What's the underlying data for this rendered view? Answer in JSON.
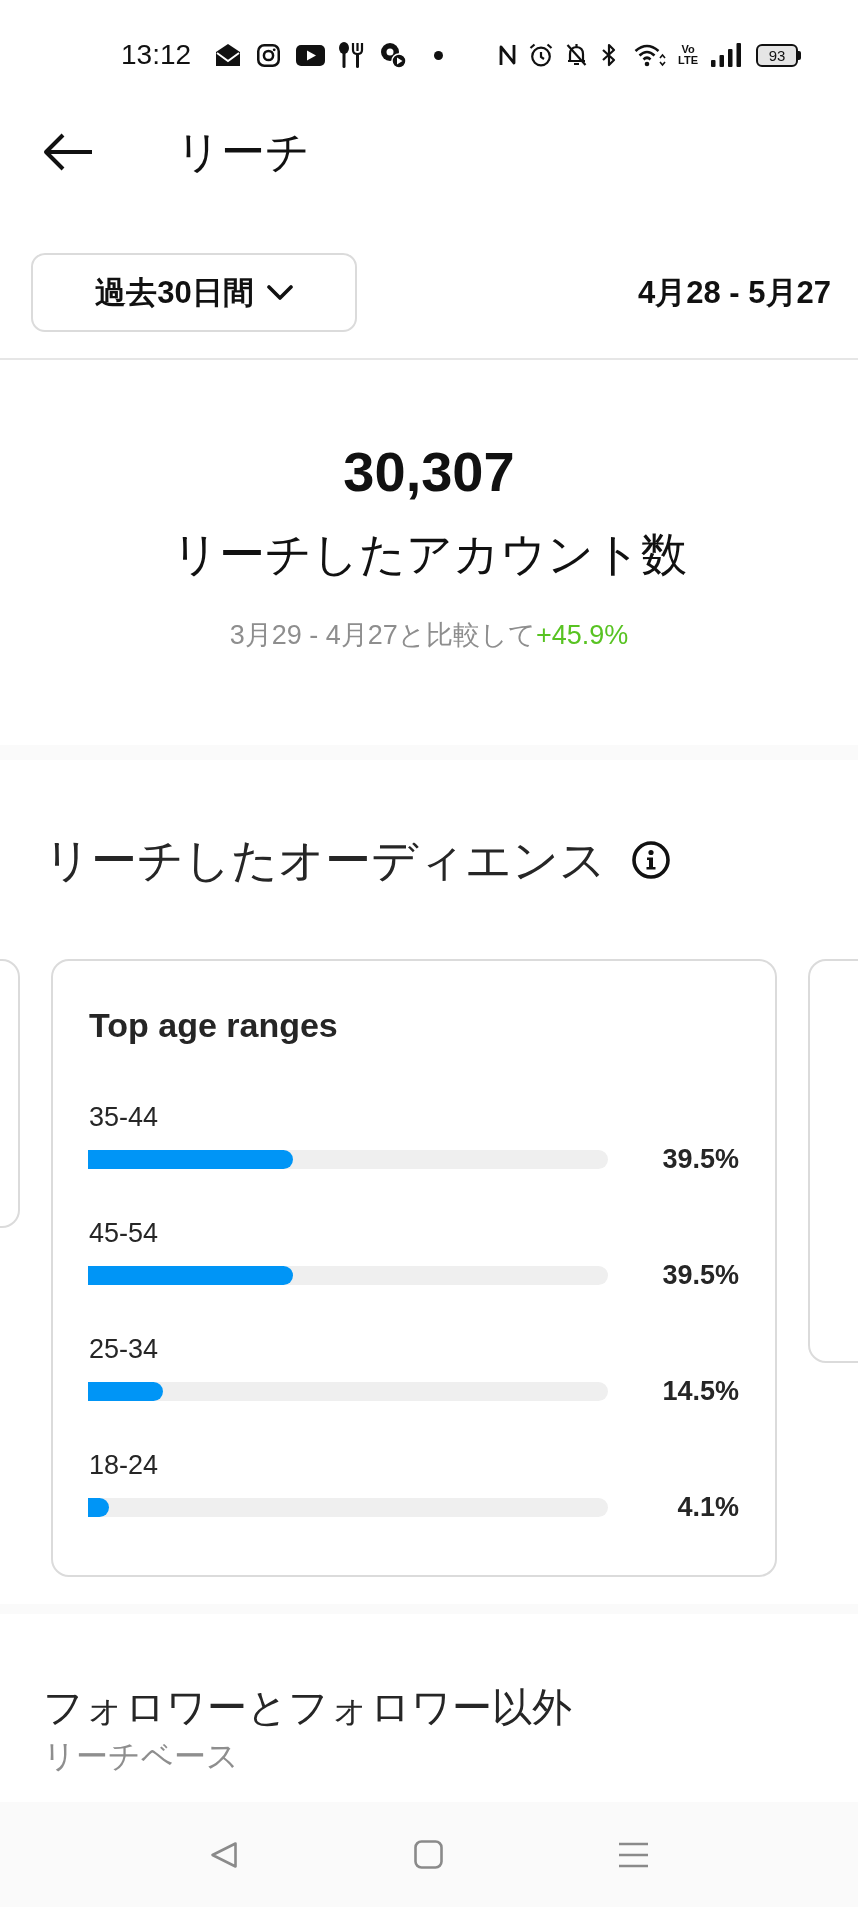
{
  "status_bar": {
    "time": "13:12",
    "network_label": "Vo\nLTE",
    "battery": "93"
  },
  "header": {
    "title": "リーチ"
  },
  "filter": {
    "period": "過去30日間",
    "date_range": "4月28 - 5月27"
  },
  "summary": {
    "value": "30,307",
    "label": "リーチしたアカウント数",
    "comparison": "3月29 - 4月27と比較して",
    "change": "+45.9%"
  },
  "audience": {
    "title": "リーチしたオーディエンス",
    "card": {
      "title": "Top age ranges",
      "rows": [
        {
          "label": "35-44",
          "level": 0.395,
          "reading": "39.5%"
        },
        {
          "label": "45-54",
          "level": 0.395,
          "reading": "39.5%"
        },
        {
          "label": "25-34",
          "level": 0.145,
          "reading": "14.5%"
        },
        {
          "label": "18-24",
          "level": 0.041,
          "reading": "4.1%"
        }
      ]
    }
  },
  "followers_section": {
    "title": "フォロワーとフォロワー以外",
    "subtitle": "リーチベース"
  }
}
